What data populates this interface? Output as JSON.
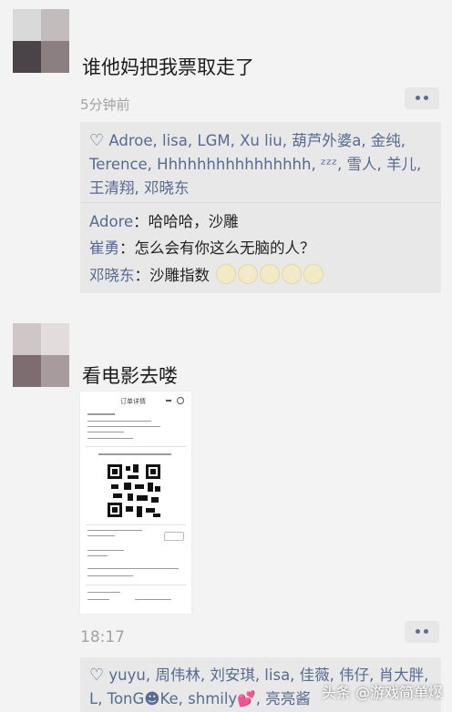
{
  "posts": [
    {
      "text": "谁他妈把我票取走了",
      "time": "5分钟前",
      "likes": "Adroe, lisa, LGM, Xu liu, 葫芦外婆a, 金纯, Terence, Hhhhhhhhhhhhhhhh, ᶻᶻᶻ, 雪人, 羊儿, 王清翔, 邓晓东",
      "comments": [
        {
          "author": "Adore",
          "sep": "：",
          "text": "哈哈哈，沙雕"
        },
        {
          "author": "崔勇",
          "sep": "：",
          "text": "怎么会有你这么无脑的人？"
        },
        {
          "author": "邓晓东",
          "sep": "：",
          "text": "沙雕指数"
        }
      ]
    },
    {
      "text": "看电影去喽",
      "time": "18:17",
      "likes": "yuyu, 周伟林, 刘安琪, lisa, 佳薇, 伟仔, 肖大胖, L, TonG☻Ke, shmily💕, 亮亮酱"
    }
  ],
  "ticket": {
    "title": "订单详情"
  },
  "watermark": "头条 @游戏简单爆",
  "colors": {
    "background": "#f3f3f3",
    "panel": "#e8e8e8",
    "name_link": "#566a92",
    "time": "#a2a2a2"
  },
  "icons": [
    "heart-icon",
    "more-icon",
    "qr-code-icon",
    "emoji-icon"
  ]
}
